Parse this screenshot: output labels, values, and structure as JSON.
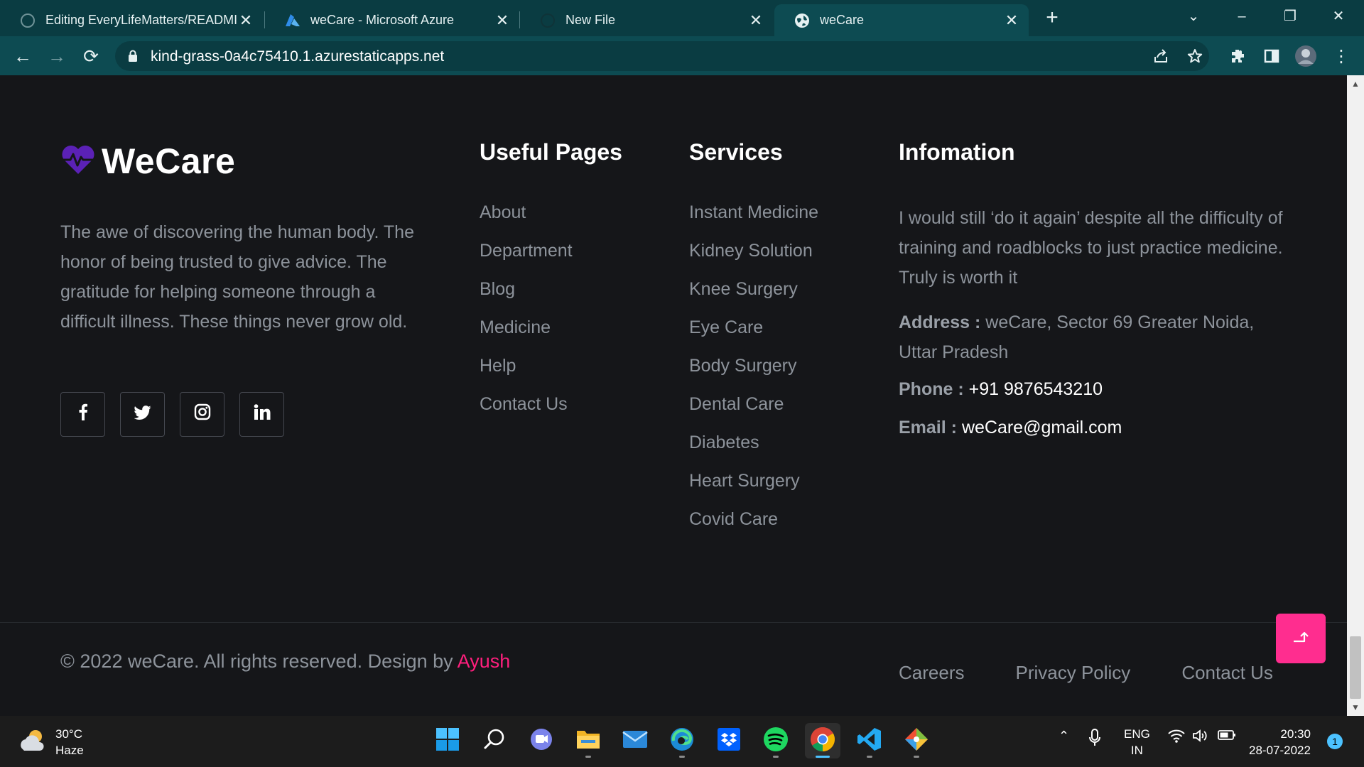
{
  "browser": {
    "tabs": [
      {
        "title": "Editing EveryLifeMatters/READMI",
        "icon": "github-icon",
        "active": false
      },
      {
        "title": "weCare - Microsoft Azure",
        "icon": "azure-icon",
        "active": false
      },
      {
        "title": "New File",
        "icon": "github-icon",
        "active": false
      },
      {
        "title": "weCare",
        "icon": "globe-icon",
        "active": true
      }
    ],
    "url": "kind-grass-0a4c75410.1.azurestaticapps.net"
  },
  "footer": {
    "brand": {
      "name": "WeCare"
    },
    "about_text": "The awe of discovering the human body. The honor of being trusted to give advice. The gratitude for helping someone through a difficult illness. These things never grow old.",
    "socials": [
      {
        "name": "facebook",
        "glyph": "f"
      },
      {
        "name": "twitter",
        "glyph": "t"
      },
      {
        "name": "instagram",
        "glyph": "ig"
      },
      {
        "name": "linkedin",
        "glyph": "in"
      }
    ],
    "useful_pages": {
      "title": "Useful Pages",
      "links": [
        "About",
        "Department",
        "Blog",
        "Medicine",
        "Help",
        "Contact Us"
      ]
    },
    "services": {
      "title": "Services",
      "links": [
        "Instant Medicine",
        "Kidney Solution",
        "Knee Surgery",
        "Eye Care",
        "Body Surgery",
        "Dental Care",
        "Diabetes",
        "Heart Surgery",
        "Covid Care"
      ]
    },
    "information": {
      "title": "Infomation",
      "text": "I would still ‘do it again’ despite all the difficulty of training and roadblocks to just practice medicine. Truly is worth it",
      "address_label": "Address :",
      "address_value": "weCare, Sector 69 Greater Noida, Uttar Pradesh",
      "phone_label": "Phone :",
      "phone_value": "+91 9876543210",
      "email_label": "Email :",
      "email_value": "weCare@gmail.com"
    },
    "copyright_text": "© 2022 weCare. All rights reserved. Design by ",
    "copyright_author": "Ayush",
    "bottom_links": [
      "Careers",
      "Privacy Policy",
      "Contact Us"
    ]
  },
  "taskbar": {
    "weather": {
      "temp": "30°C",
      "condition": "Haze"
    },
    "language": {
      "line1": "ENG",
      "line2": "IN"
    },
    "time": "20:30",
    "date": "28-07-2022",
    "notifications": "1"
  },
  "colors": {
    "page_bg": "#151619",
    "accent_pink": "#ff1f7d",
    "browser_teal": "#0d4b52",
    "logo_purple": "#5b21b6"
  }
}
